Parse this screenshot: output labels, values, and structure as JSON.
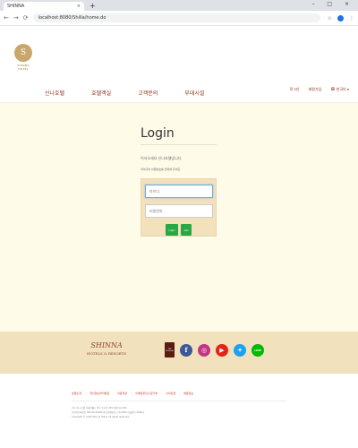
{
  "browser": {
    "tab_title": "SHINNA",
    "tab_close": "×",
    "new_tab": "+",
    "window_controls": "–  □  ×",
    "url": "localhost:8080/Shilla/home.do"
  },
  "header": {
    "logo_text": "SHINNA HOTEL",
    "menu": [
      "신나호텔",
      "호텔객실",
      "고객문의",
      "부대시설"
    ],
    "util_links": {
      "login": "로그인",
      "join": "회원가입",
      "language": "한국어"
    }
  },
  "login": {
    "title": "Login",
    "welcome": "어서오세요 신나호텔입니다",
    "notice": "아이디와 비밀번호를 입력해 주세요",
    "id_placeholder": "아이디",
    "pw_placeholder": "비밀번호",
    "login_button": "Login",
    "join_button": "Join"
  },
  "footer": {
    "brand_name": "SHINNA",
    "brand_sub": "HOTELS & RESORTS",
    "book_label_1": "THE",
    "book_label_2": "Shinnadi",
    "social": [
      "facebook-icon",
      "instagram-icon",
      "youtube-icon",
      "twitter-icon",
      "line-icon"
    ],
    "links": [
      "호텔소개",
      "개인정보처리방침",
      "이용약관",
      "이메일무단수집거부",
      "사이트맵",
      "채용정보"
    ],
    "info_1": "(주) 신나 호텔 서울특별시 중구 동호로 249 대표이사 000",
    "info_2": "사업자등록번호 000-00-00000 통신판매업신고 제 0000-서울중구-0000호",
    "info_3": "Copyright © 2020 Shinna Hotel. All rights reserved."
  },
  "colors": {
    "accent": "#8b2b12",
    "page_bg": "#fffbe9",
    "panel_bg": "#f3e1bb",
    "button": "#28a745"
  }
}
